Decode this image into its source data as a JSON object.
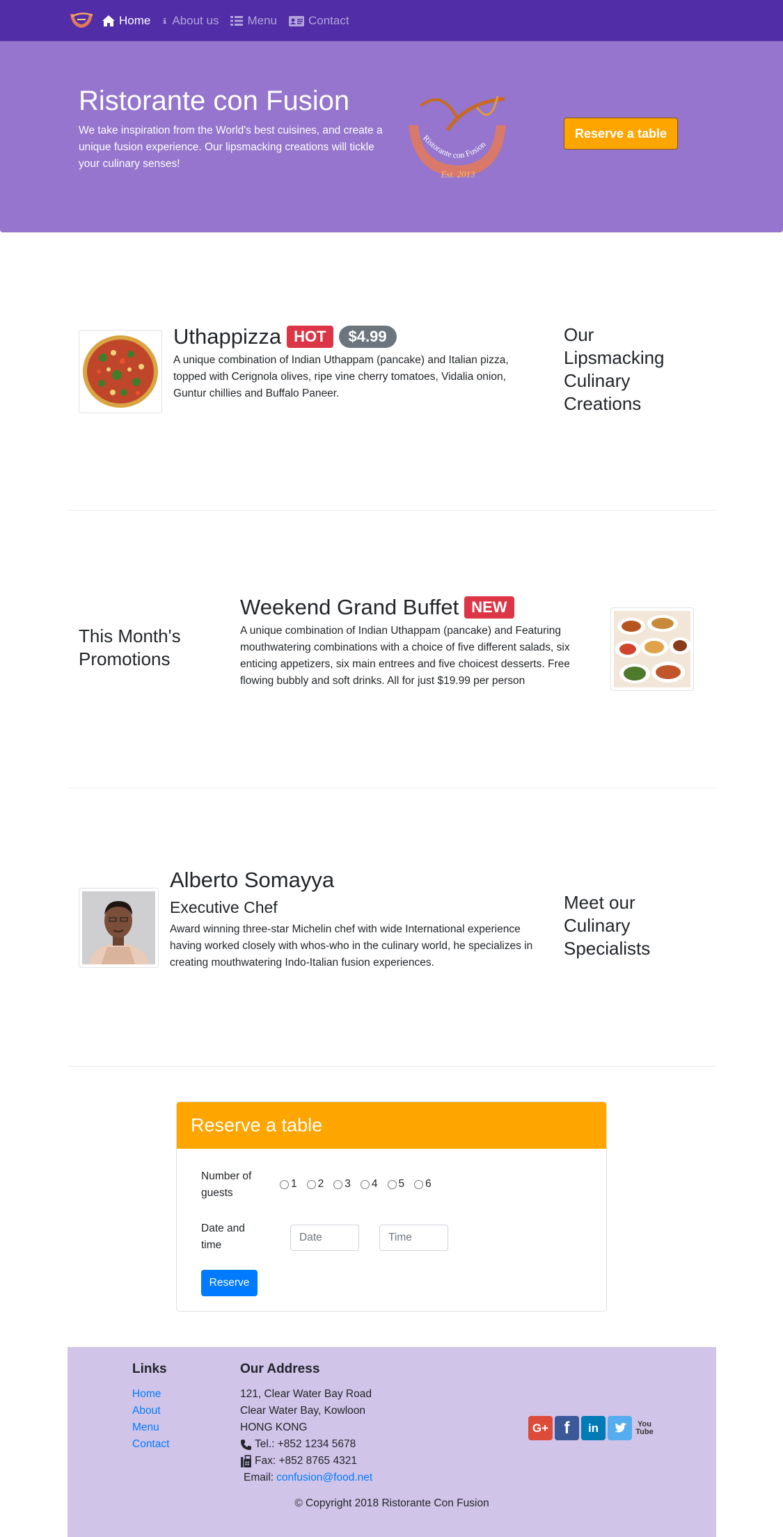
{
  "nav": {
    "items": [
      {
        "label": "Home",
        "icon": "home-icon",
        "active": true
      },
      {
        "label": "About us",
        "icon": "info-icon"
      },
      {
        "label": "Menu",
        "icon": "list-icon"
      },
      {
        "label": "Contact",
        "icon": "address-card-icon"
      }
    ]
  },
  "jumbotron": {
    "title": "Ristorante con Fusion",
    "text": "We take inspiration from the World's best cuisines, and create a unique fusion experience. Our lipsmacking creations will tickle your culinary senses!",
    "logo_text": "Ristorante con Fusion",
    "logo_est": "Est. 2013",
    "button": "Reserve a table"
  },
  "dish": {
    "name": "Uthappizza",
    "badge": "HOT",
    "price": "$4.99",
    "description": "A unique combination of Indian Uthappam (pancake) and Italian pizza, topped with Cerignola olives, ripe vine cherry tomatoes, Vidalia onion, Guntur chillies and Buffalo Paneer.",
    "side_heading": "Our Lipsmacking Culinary Creations"
  },
  "promotion": {
    "name": "Weekend Grand Buffet",
    "badge": "NEW",
    "description": "A unique combination of Indian Uthappam (pancake) and Featuring mouthwatering combinations with a choice of five different salads, six enticing appetizers, six main entrees and five choicest desserts. Free flowing bubbly and soft drinks. All for just $19.99 per person",
    "side_heading": "This Month's Promotions"
  },
  "leader": {
    "name": "Alberto Somayya",
    "designation": "Executive Chef",
    "description": "Award winning three-star Michelin chef with wide International experience having worked closely with whos-who in the culinary world, he specializes in creating mouthwatering Indo-Italian fusion experiences.",
    "side_heading": "Meet our Culinary Specialists"
  },
  "reserve": {
    "title": "Reserve a table",
    "guests_label": "Number of guests",
    "guest_options": [
      "1",
      "2",
      "3",
      "4",
      "5",
      "6"
    ],
    "datetime_label": "Date and time",
    "date_placeholder": "Date",
    "time_placeholder": "Time",
    "submit": "Reserve"
  },
  "footer": {
    "links_title": "Links",
    "links": [
      "Home",
      "About",
      "Menu",
      "Contact"
    ],
    "address_title": "Our Address",
    "address_lines": [
      "121, Clear Water Bay Road",
      "Clear Water Bay, Kowloon",
      "HONG KONG"
    ],
    "tel": "Tel.: +852 1234 5678",
    "fax": "Fax: +852 8765 4321",
    "email_label": "Email:",
    "email": "confusion@food.net",
    "social": [
      {
        "icon": "google-plus-icon",
        "label": "G+",
        "color": "#dd4b39"
      },
      {
        "icon": "facebook-icon",
        "label": "f",
        "color": "#3b5998"
      },
      {
        "icon": "linkedin-icon",
        "label": "in",
        "color": "#007bb5"
      },
      {
        "icon": "twitter-icon",
        "label": "t",
        "color": "#55acee"
      },
      {
        "icon": "youtube-icon",
        "label": "You Tube",
        "color": "#333333"
      }
    ],
    "copyright": "© Copyright 2018 Ristorante Con Fusion"
  },
  "colors": {
    "navbar": "#512da8",
    "jumbotron": "#9575cd",
    "accent": "#ffa500",
    "footer": "#d1c4e9",
    "primary": "#007bff"
  }
}
